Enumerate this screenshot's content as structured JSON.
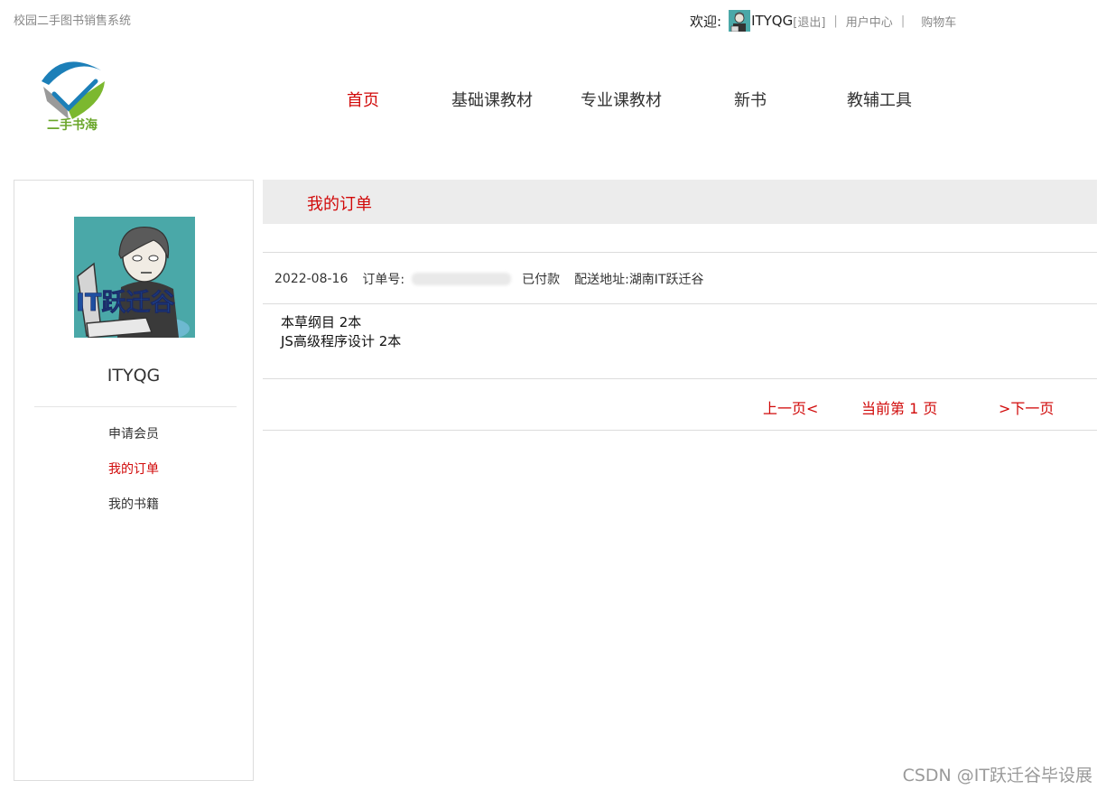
{
  "site_name": "校园二手图书销售系统",
  "userbar": {
    "welcome": "欢迎:",
    "username": "ITYQG",
    "logout": "[退出]",
    "sep": "|",
    "user_center": "用户中心",
    "cart": "购物车"
  },
  "logo": {
    "text": "二手书海"
  },
  "nav": {
    "items": [
      {
        "label": "首页",
        "active": true
      },
      {
        "label": "基础课教材"
      },
      {
        "label": "专业课教材"
      },
      {
        "label": "新书"
      },
      {
        "label": "教辅工具"
      }
    ]
  },
  "sidebar": {
    "avatar_text": "IT跃迁谷",
    "username": "ITYQG",
    "menu": [
      {
        "label": "申请会员"
      },
      {
        "label": "我的订单",
        "active": true
      },
      {
        "label": "我的书籍"
      }
    ]
  },
  "main": {
    "title": "我的订单",
    "order": {
      "date": "2022-08-16",
      "order_no_label": "订单号:",
      "status": "已付款",
      "address_label": "配送地址:",
      "address": "湖南IT跃迁谷",
      "items": [
        "本草纲目 2本",
        "JS高级程序设计 2本"
      ]
    },
    "pager": {
      "prev": "上一页<",
      "current": "当前第 1 页",
      "next": ">下一页"
    }
  },
  "watermark": "CSDN @IT跃迁谷毕设展",
  "colors": {
    "accent": "#d10a0a",
    "header_bg": "#ececec",
    "logo_green": "#6aa62a",
    "logo_blue": "#1c7fb8"
  },
  "icons": {
    "logo": "book-check-logo-icon",
    "avatar": "cartoon-programmer-avatar"
  }
}
